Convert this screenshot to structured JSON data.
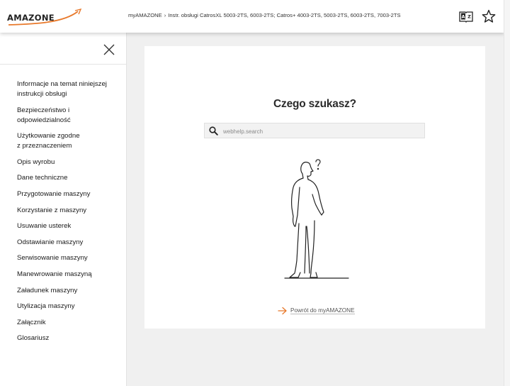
{
  "header": {
    "logo_text": "AMAZONE",
    "breadcrumb": {
      "home": "myAMAZONE",
      "separator": "›",
      "current": "Instr. obsługi CatrosXL 5003-2TS, 6003-2TS; Catros+ 4003-2TS, 5003-2TS, 6003-2TS, 7003-2TS"
    },
    "icons": [
      "dictionary-icon",
      "star-icon"
    ]
  },
  "sidebar": {
    "close_icon": "close-icon",
    "items": [
      {
        "label": "Informacje na temat niniejszej\ninstrukcji obsługi"
      },
      {
        "label": "Bezpieczeństwo i odpowiedzialność"
      },
      {
        "label": "Użytkowanie zgodne\nz przeznaczeniem"
      },
      {
        "label": "Opis wyrobu"
      },
      {
        "label": "Dane techniczne"
      },
      {
        "label": "Przygotowanie maszyny"
      },
      {
        "label": "Korzystanie z maszyny"
      },
      {
        "label": "Usuwanie usterek"
      },
      {
        "label": "Odstawianie maszyny"
      },
      {
        "label": "Serwisowanie maszyny"
      },
      {
        "label": "Manewrowanie maszyną"
      },
      {
        "label": "Załadunek maszyny"
      },
      {
        "label": "Utylizacja maszyny"
      },
      {
        "label": "Załącznik"
      },
      {
        "label": "Glosariusz"
      }
    ]
  },
  "main": {
    "title": "Czego szukasz?",
    "search": {
      "placeholder": "webhelp.search",
      "value": ""
    },
    "back_link": "Powrót do myAMAZONE",
    "accent_color": "#e8792b"
  }
}
